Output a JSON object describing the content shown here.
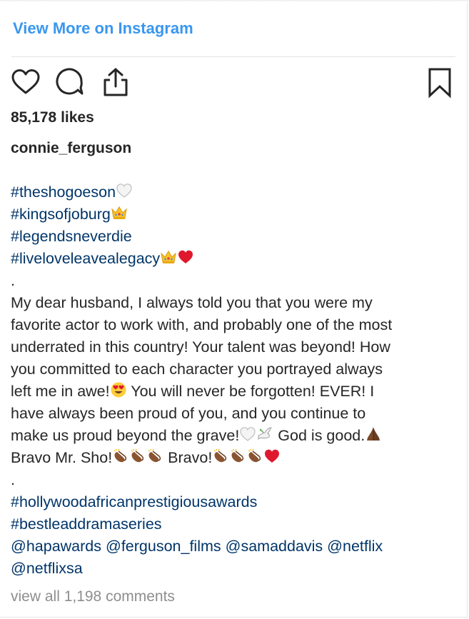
{
  "header": {
    "view_more_link": "View More on Instagram"
  },
  "actions": {
    "like_icon": "heart-outline-icon",
    "comment_icon": "speech-bubble-icon",
    "share_icon": "share-upload-icon",
    "save_icon": "bookmark-icon"
  },
  "post": {
    "likes": "85,178 likes",
    "username": "connie_ferguson",
    "hashtags_top": [
      "#theshogoeson",
      "#kingsofjoburg",
      "#legendsneverdie",
      "#liveloveleavealegacy"
    ],
    "dot_1": ".",
    "body_lines": [
      "My dear husband, I always told you that you were my",
      "favorite actor to work with, and probably one of the most",
      "underrated in this country! Your talent was beyond! How",
      "you committed to each character you portrayed always",
      "left me in awe!",
      " You will never be forgotten! EVER! I",
      "have always been proud of you, and you continue to",
      "make us proud beyond the grave!",
      " God is good.",
      "Bravo Mr. Sho!",
      " Bravo!"
    ],
    "dot_2": ".",
    "hashtags_bottom": [
      "#hollywoodafricanprestigiousawards",
      "#bestleaddramaseries"
    ],
    "mentions": [
      "@hapawards",
      "@ferguson_films",
      "@samaddavis",
      "@netflix",
      "@netflixsa"
    ],
    "emojis": {
      "white_heart": "white-heart-emoji",
      "crown": "crown-emoji",
      "red_heart": "red-heart-emoji",
      "heart_eyes": "smiling-face-with-heart-eyes-emoji",
      "dove": "dove-emoji",
      "praying_hands": "folded-hands-emoji",
      "clapping": "clapping-hands-emoji"
    }
  },
  "footer": {
    "view_comments": "view all 1,198 comments"
  },
  "colors": {
    "link_blue": "#3897f0",
    "hashtag_blue": "#003569",
    "text": "#262626",
    "muted": "#8e8e8e"
  }
}
